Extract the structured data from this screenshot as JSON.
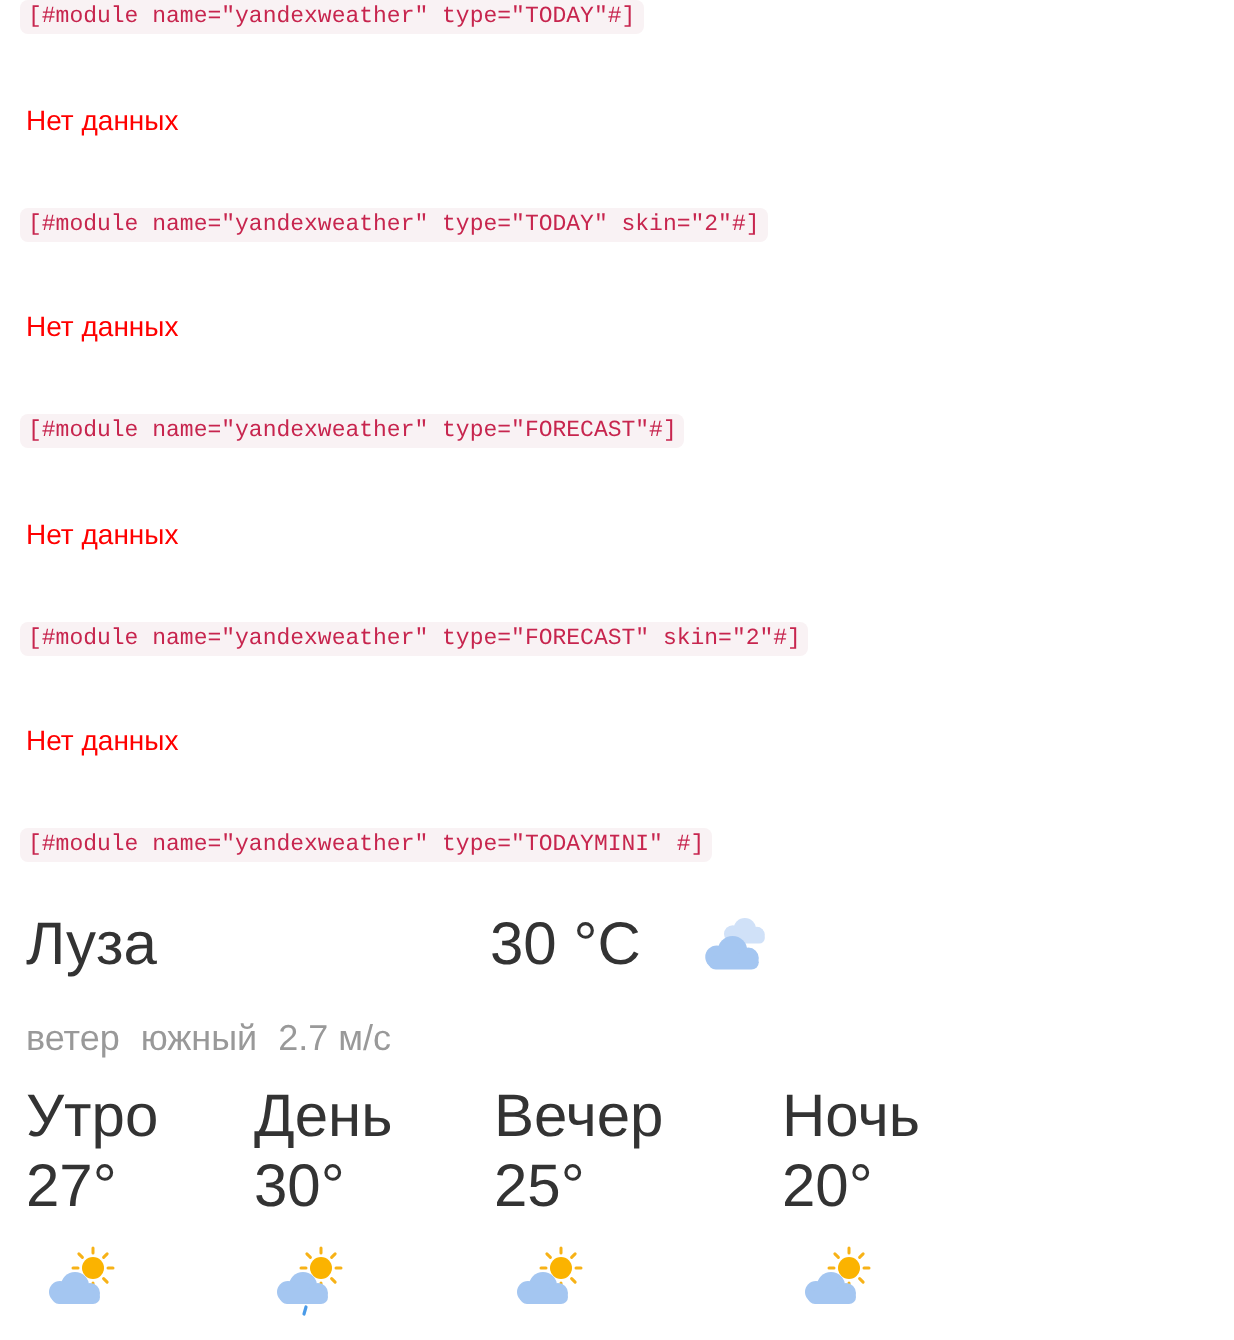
{
  "blocks": [
    {
      "code": "[#module name=\"yandexweather\" type=\"TODAY\"#]",
      "output": {
        "kind": "message",
        "text": "Нет данных"
      }
    },
    {
      "code": "[#module name=\"yandexweather\" type=\"TODAY\" skin=\"2\"#]",
      "output": {
        "kind": "message",
        "text": "Нет данных"
      }
    },
    {
      "code": "[#module name=\"yandexweather\" type=\"FORECAST\"#]",
      "output": {
        "kind": "message",
        "text": "Нет данных"
      }
    },
    {
      "code": "[#module name=\"yandexweather\" type=\"FORECAST\" skin=\"2\"#]",
      "output": {
        "kind": "message",
        "text": "Нет данных"
      }
    },
    {
      "code": "[#module name=\"yandexweather\" type=\"TODAYMINI\" #]",
      "output": {
        "kind": "weather",
        "city": "Луза",
        "temperature": "30 °C",
        "wind": {
          "label": "ветер",
          "direction": "южный",
          "speed": "2.7 м/с"
        },
        "periods": [
          {
            "name": "Утро",
            "temperature": "27°",
            "kind": "partly-cloudy"
          },
          {
            "name": "День",
            "temperature": "30°",
            "kind": "partly-cloudy-rain"
          },
          {
            "name": "Вечер",
            "temperature": "25°",
            "kind": "partly-cloudy"
          },
          {
            "name": "Ночь",
            "temperature": "20°",
            "kind": "partly-cloudy"
          }
        ]
      }
    }
  ]
}
